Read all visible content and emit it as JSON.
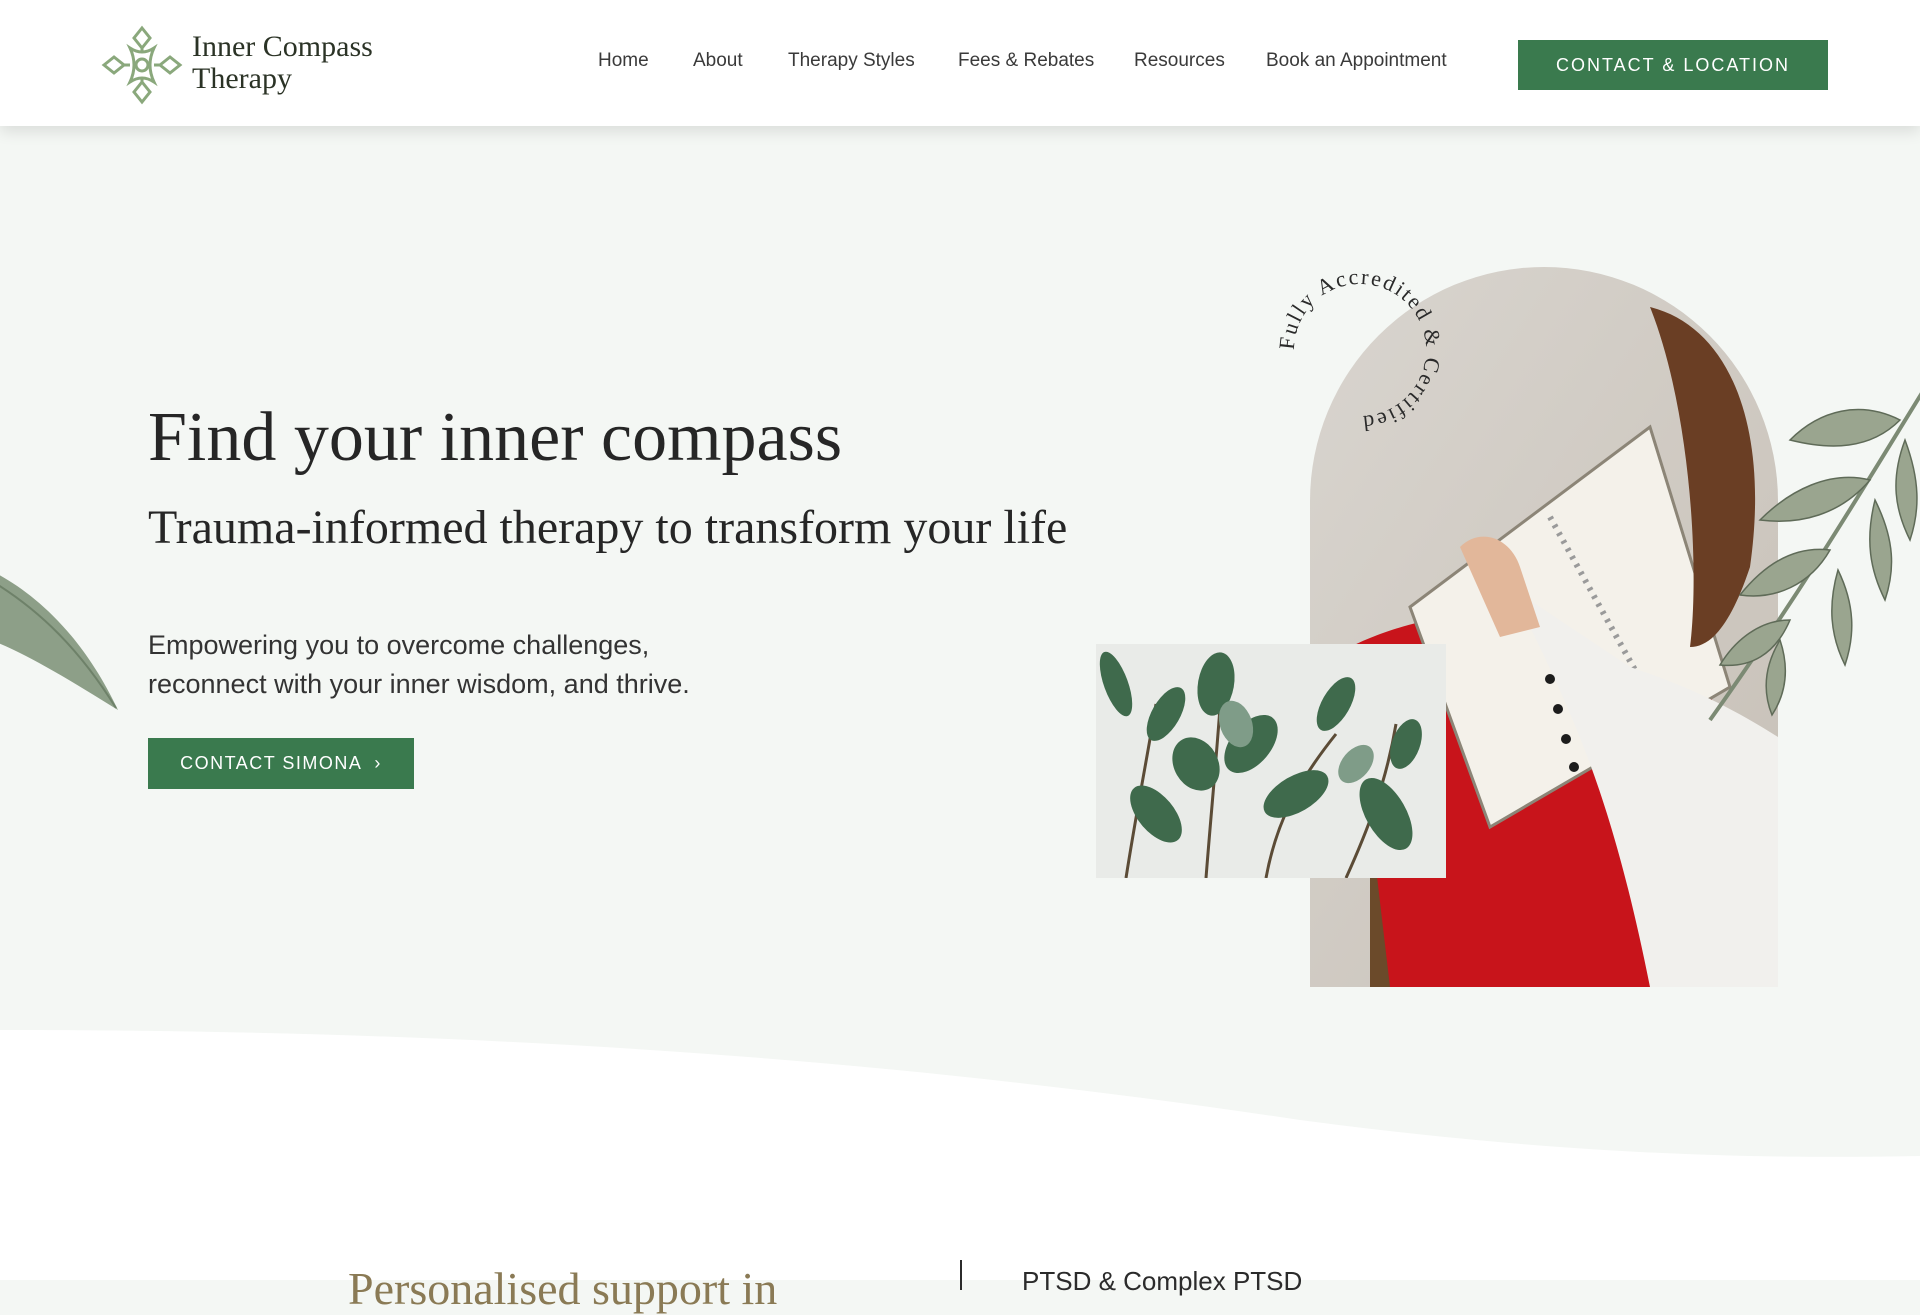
{
  "brand": {
    "name_line1": "Inner Compass",
    "name_line2": "Therapy",
    "color_primary": "#3a7a4e",
    "color_logo": "#8aa87c"
  },
  "nav": {
    "items": [
      {
        "label": "Home"
      },
      {
        "label": "About"
      },
      {
        "label": "Therapy Styles"
      },
      {
        "label": "Fees & Rebates"
      },
      {
        "label": "Resources"
      },
      {
        "label": "Book an Appointment"
      }
    ],
    "cta_label": "CONTACT & LOCATION"
  },
  "hero": {
    "title": "Find your inner compass",
    "subtitle": "Trauma-informed therapy to transform your life",
    "body_line1": "Empowering you to overcome challenges,",
    "body_line2": "reconnect with your inner wisdom, and thrive.",
    "cta_label": "CONTACT SIMONA",
    "badge_text": "Fully Accredited & Certified"
  },
  "next_section": {
    "left_heading_partial": "Personalised support in",
    "right_text_partial": "PTSD & Complex PTSD"
  }
}
